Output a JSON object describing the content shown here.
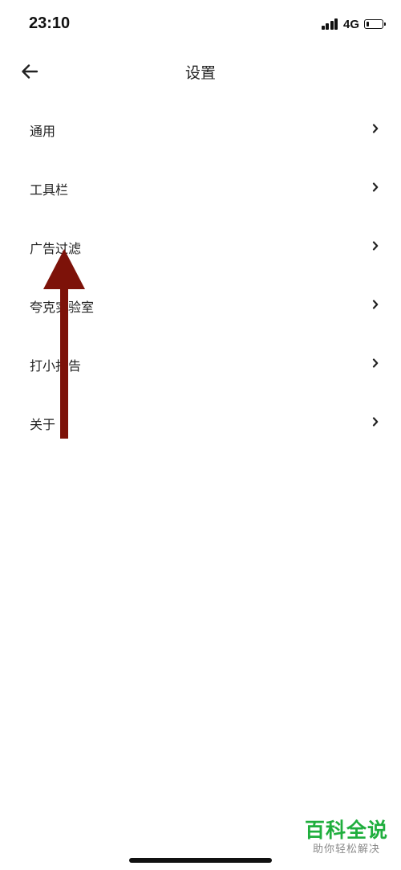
{
  "status_bar": {
    "time": "23:10",
    "network": "4G",
    "signal_bars": 4,
    "battery_level": 0.15
  },
  "header": {
    "title": "设置",
    "back_icon": "arrow-left-icon"
  },
  "settings_list": {
    "items": [
      {
        "label": "通用",
        "icon": "chevron-right-icon"
      },
      {
        "label": "工具栏",
        "icon": "chevron-right-icon"
      },
      {
        "label": "广告过滤",
        "icon": "chevron-right-icon"
      },
      {
        "label": "夸克实验室",
        "icon": "chevron-right-icon"
      },
      {
        "label": "打小报告",
        "icon": "chevron-right-icon"
      },
      {
        "label": "关于",
        "icon": "chevron-right-icon"
      }
    ]
  },
  "annotation": {
    "arrow_color": "#7d1209"
  },
  "watermark": {
    "title": "百科全说",
    "subtitle": "助你轻松解决",
    "title_color": "#1fae3d"
  }
}
